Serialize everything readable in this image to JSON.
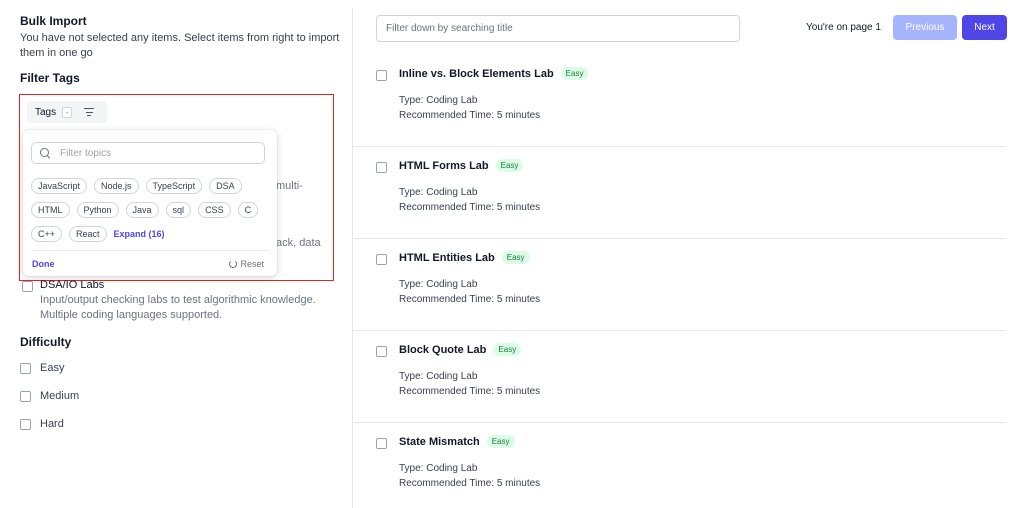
{
  "sidebar": {
    "bulk_import_title": "Bulk Import",
    "bulk_import_desc": "You have not selected any items. Select items from right to import them in one go",
    "filter_tags_heading": "Filter Tags",
    "tags_button_label": "Tags",
    "tags_count": "-",
    "topic_search_placeholder": "Filter topics",
    "topic_chips": [
      [
        "JavaScript",
        "Node.js",
        "TypeScript",
        "DSA"
      ],
      [
        "HTML",
        "Python",
        "Java",
        "sql",
        "CSS",
        "C"
      ],
      [
        "C++",
        "React"
      ]
    ],
    "expand_label": "Expand (16)",
    "done_label": "Done",
    "reset_label": "Reset",
    "partial_text_1": "multi-",
    "partial_text_2": "ack, data",
    "dsa_label": "DSA/IO Labs",
    "dsa_desc": "Input/output checking labs to test algorithmic knowledge. Multiple coding languages supported.",
    "difficulty_heading": "Difficulty",
    "difficulty_options": [
      "Easy",
      "Medium",
      "Hard"
    ]
  },
  "main": {
    "title_search_placeholder": "Filter down by searching title",
    "page_indicator": "You're on page 1",
    "previous_label": "Previous",
    "next_label": "Next",
    "labs": [
      {
        "title": "Inline vs. Block Elements Lab",
        "badge": "Easy",
        "type": "Type: Coding Lab",
        "time": "Recommended Time: 5 minutes"
      },
      {
        "title": "HTML Forms Lab",
        "badge": "Easy",
        "type": "Type: Coding Lab",
        "time": "Recommended Time: 5 minutes"
      },
      {
        "title": "HTML Entities Lab",
        "badge": "Easy",
        "type": "Type: Coding Lab",
        "time": "Recommended Time: 5 minutes"
      },
      {
        "title": "Block Quote Lab",
        "badge": "Easy",
        "type": "Type: Coding Lab",
        "time": "Recommended Time: 5 minutes"
      },
      {
        "title": "State Mismatch",
        "badge": "Easy",
        "type": "Type: Coding Lab",
        "time": "Recommended Time: 5 minutes"
      }
    ]
  },
  "colors": {
    "accent": "#4f46e5",
    "accent_disabled": "#a5b4fc",
    "highlight_border": "#dc2626",
    "easy_badge_bg": "#dcfce7",
    "easy_badge_text": "#15803d"
  }
}
